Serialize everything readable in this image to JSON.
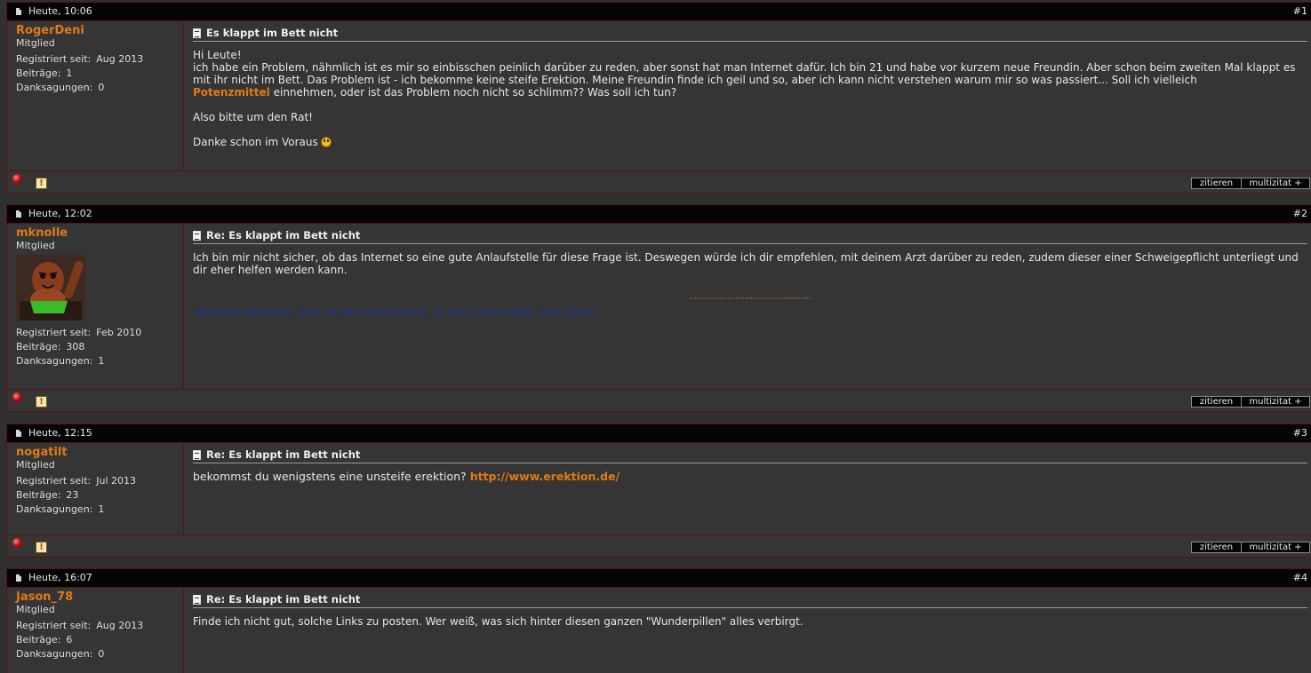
{
  "labels": {
    "registered": "Registriert seit:",
    "posts": "Beiträge:",
    "thanks": "Danksagungen:",
    "quote_button": "zitieren",
    "multiquote_button": "multizitat +",
    "report_icon": "!"
  },
  "icons": {
    "date": "document-icon",
    "title": "post-icon",
    "online": "offline-status-icon",
    "report": "report-icon"
  },
  "colors": {
    "username": "#e07b14",
    "link": "#e07b14",
    "signature": "#1a2a9a",
    "border": "#5a1212",
    "header_bg": "#050505"
  },
  "posts": [
    {
      "date": "Heute, 10:06",
      "num": "#1",
      "username": "RogerDeni",
      "usertitle": "Mitglied",
      "registered": "Aug 2013",
      "posts": "1",
      "thanks": "0",
      "title": "Es klappt im Bett nicht",
      "body": {
        "greeting": "Hi Leute!",
        "text1": "ich habe ein Problem, nähmlich ist es mir so einbisschen peinlich darüber zu reden, aber sonst hat man Internet dafür. Ich bin 21 und habe vor kurzem neue Freundin. Aber schon beim zweiten Mal klappt es mit ihr nicht im Bett. Das Problem ist - ich bekomme keine steife Erektion. Meine Freundin finde ich geil und so, aber ich kann nicht verstehen warum mir so was passiert... Soll ich vielleich",
        "link": "Potenzmittel",
        "text2": " einnehmen, oder ist das Problem noch nicht so schlimm?? Was soll ich tun?",
        "line2": "Also bitte um den Rat!",
        "line3": "Danke schon im Voraus"
      }
    },
    {
      "date": "Heute, 12:02",
      "num": "#2",
      "username": "mknolle",
      "usertitle": "Mitglied",
      "registered": "Feb 2010",
      "posts": "308",
      "thanks": "1",
      "title": "Re: Es klappt im Bett nicht",
      "body": {
        "text": "Ich bin mir nicht sicher, ob das Internet so eine gute Anlaufstelle für diese Frage ist. Deswegen würde ich dir empfehlen, mit deinem Arzt darüber zu reden, zudem dieser einer Schweigepflicht unterliegt und dir eher helfen werden kann.",
        "sig_divider": ",,,,,,,,,,,,,,,,,,,,,,,,,,,,,,,,,,,,,,,,,,,,,,,,",
        "signature": "Wenn wir bedenken, dass wir alle verrückt sind, ist das Leben erklärt. Mark Twain"
      }
    },
    {
      "date": "Heute, 12:15",
      "num": "#3",
      "username": "nogatilt",
      "usertitle": "Mitglied",
      "registered": "Jul 2013",
      "posts": "23",
      "thanks": "1",
      "title": "Re: Es klappt im Bett nicht",
      "body": {
        "text": "bekommst du wenigstens eine unsteife erektion?",
        "link": "http://www.erektion.de/"
      }
    },
    {
      "date": "Heute, 16:07",
      "num": "#4",
      "username": "Jason_78",
      "usertitle": "Mitglied",
      "registered": "Aug 2013",
      "posts": "6",
      "thanks": "0",
      "title": "Re: Es klappt im Bett nicht",
      "body": {
        "text": "Finde ich nicht gut, solche Links zu posten. Wer weiß, was sich hinter diesen ganzen \"Wunderpillen\" alles verbirgt."
      }
    }
  ]
}
